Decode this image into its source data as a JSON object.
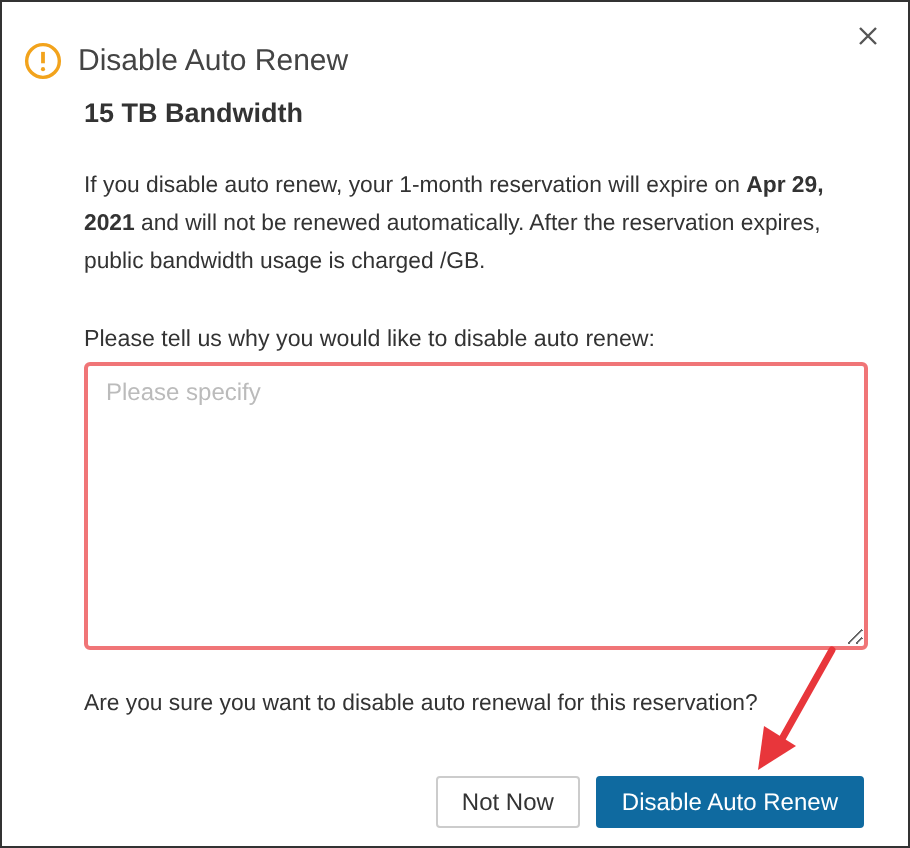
{
  "dialog": {
    "title": "Disable Auto Renew",
    "subtitle": "15 TB Bandwidth",
    "message": "If you disable auto renew, your 1-month reservation will expire on **Apr 29, 2021** and will not be renewed automatically. After the reservation expires, public bandwidth usage is charged /GB.",
    "reason_label": "Please tell us why you would like to disable auto renew:",
    "reason_field": {
      "placeholder": "Please specify",
      "invalid": true
    },
    "question": "Are you sure you want to disable auto renewal for this reservation?",
    "buttons": [
      {
        "label": "Not Now",
        "kind": "secondary"
      },
      {
        "label": "Disable Auto Renew",
        "kind": "primary"
      }
    ]
  }
}
